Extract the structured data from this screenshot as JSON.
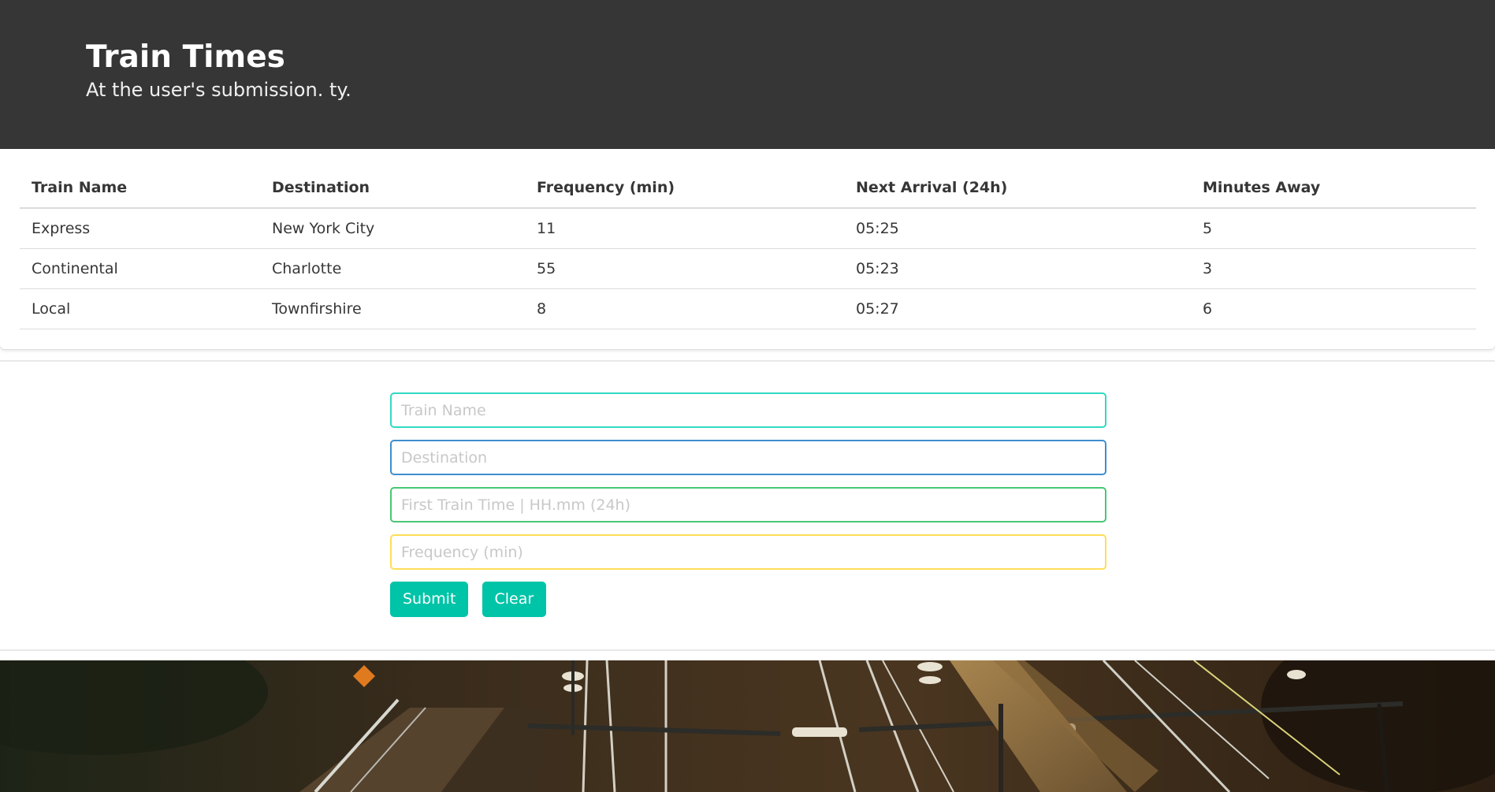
{
  "header": {
    "title": "Train Times",
    "subtitle": "At the user's submission. ty."
  },
  "table": {
    "columns": [
      "Train Name",
      "Destination",
      "Frequency (min)",
      "Next Arrival (24h)",
      "Minutes Away"
    ],
    "rows": [
      [
        "Express",
        "New York City",
        "11",
        "05:25",
        "5"
      ],
      [
        "Continental",
        "Charlotte",
        "55",
        "05:23",
        "3"
      ],
      [
        "Local",
        "Townfirshire",
        "8",
        "05:27",
        "6"
      ]
    ]
  },
  "form": {
    "train_name_placeholder": "Train Name",
    "destination_placeholder": "Destination",
    "first_time_placeholder": "First Train Time | HH.mm (24h)",
    "frequency_placeholder": "Frequency (min)",
    "submit_label": "Submit",
    "clear_label": "Clear"
  },
  "colors": {
    "hero_bg": "#363636",
    "primary_button": "#00c4a7",
    "train_name_border": "#33d9c1",
    "destination_border": "#3e8ed0",
    "first_time_border": "#48c774",
    "frequency_border": "#ffdd57"
  }
}
